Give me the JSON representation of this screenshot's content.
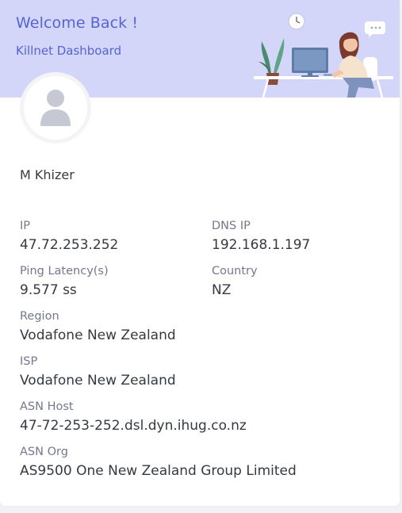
{
  "banner": {
    "welcome": "Welcome Back !",
    "subtitle": "Killnet Dashboard",
    "background_color": "#d3d6f8",
    "accent_color": "#5664d2",
    "illustration": "person-at-desk-illustration"
  },
  "profile": {
    "avatar_icon": "user-icon",
    "name": "M Khizer"
  },
  "fields": {
    "ip": {
      "label": "IP",
      "value": "47.72.253.252"
    },
    "dns_ip": {
      "label": "DNS IP",
      "value": "192.168.1.197"
    },
    "ping": {
      "label": "Ping Latency(s)",
      "value": "9.577 ss"
    },
    "country": {
      "label": "Country",
      "value": "NZ"
    },
    "region": {
      "label": "Region",
      "value": "Vodafone New Zealand"
    },
    "isp": {
      "label": "ISP",
      "value": "Vodafone New Zealand"
    },
    "asn_host": {
      "label": "ASN Host",
      "value": "47-72-253-252.dsl.dyn.ihug.co.nz"
    },
    "asn_org": {
      "label": "ASN Org",
      "value": "AS9500 One New Zealand Group Limited"
    }
  }
}
